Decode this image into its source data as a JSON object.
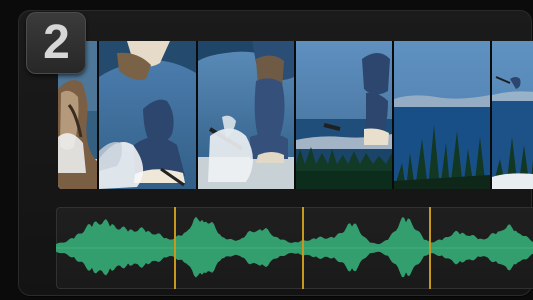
{
  "step": {
    "number": "2"
  },
  "filmstrip": {
    "frames": [
      "snowboard-frame-1",
      "snowboard-frame-2",
      "snowboard-frame-3",
      "snowboard-frame-4",
      "snowboard-frame-5",
      "snowboard-frame-6"
    ]
  },
  "audio": {
    "wave_color": "#35a774",
    "marker_color": "#c7981f",
    "markers": [
      "marker-1",
      "marker-2",
      "marker-3"
    ]
  }
}
